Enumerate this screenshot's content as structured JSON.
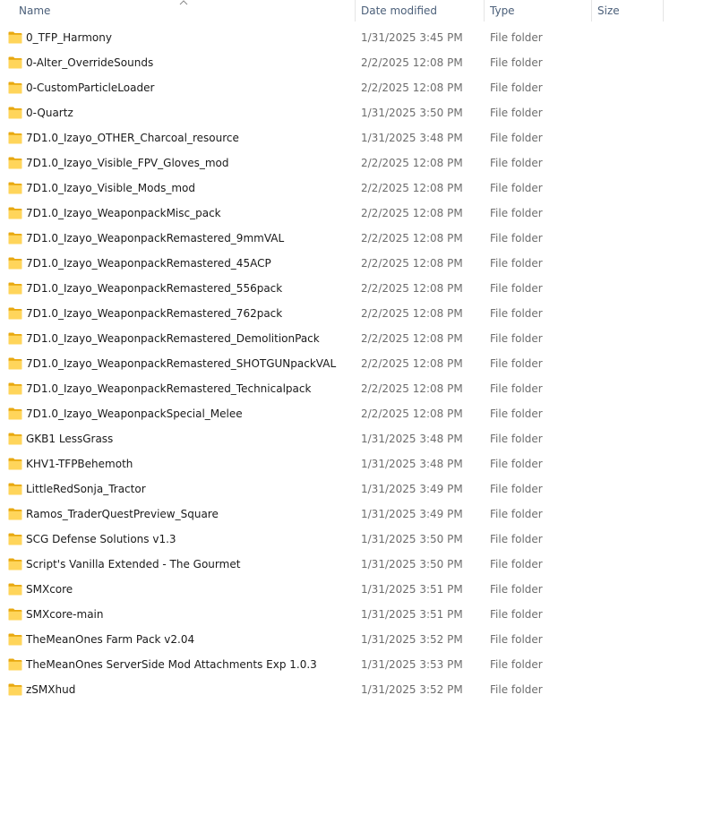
{
  "header": {
    "name": "Name",
    "date_modified": "Date modified",
    "type": "Type",
    "size": "Size"
  },
  "colors": {
    "folder_front": "#ffd55b",
    "folder_back": "#e8a810",
    "header_text": "#4c607a"
  },
  "rows": [
    {
      "name": "0_TFP_Harmony",
      "date": "1/31/2025 3:45 PM",
      "type": "File folder",
      "size": "",
      "icon": "folder-icon"
    },
    {
      "name": "0-Alter_OverrideSounds",
      "date": "2/2/2025 12:08 PM",
      "type": "File folder",
      "size": "",
      "icon": "folder-icon"
    },
    {
      "name": "0-CustomParticleLoader",
      "date": "2/2/2025 12:08 PM",
      "type": "File folder",
      "size": "",
      "icon": "folder-icon"
    },
    {
      "name": "0-Quartz",
      "date": "1/31/2025 3:50 PM",
      "type": "File folder",
      "size": "",
      "icon": "folder-icon"
    },
    {
      "name": "7D1.0_Izayo_OTHER_Charcoal_resource",
      "date": "1/31/2025 3:48 PM",
      "type": "File folder",
      "size": "",
      "icon": "folder-icon"
    },
    {
      "name": "7D1.0_Izayo_Visible_FPV_Gloves_mod",
      "date": "2/2/2025 12:08 PM",
      "type": "File folder",
      "size": "",
      "icon": "folder-icon"
    },
    {
      "name": "7D1.0_Izayo_Visible_Mods_mod",
      "date": "2/2/2025 12:08 PM",
      "type": "File folder",
      "size": "",
      "icon": "folder-icon"
    },
    {
      "name": "7D1.0_Izayo_WeaponpackMisc_pack",
      "date": "2/2/2025 12:08 PM",
      "type": "File folder",
      "size": "",
      "icon": "folder-icon"
    },
    {
      "name": "7D1.0_Izayo_WeaponpackRemastered_9mmVAL",
      "date": "2/2/2025 12:08 PM",
      "type": "File folder",
      "size": "",
      "icon": "folder-icon"
    },
    {
      "name": "7D1.0_Izayo_WeaponpackRemastered_45ACP",
      "date": "2/2/2025 12:08 PM",
      "type": "File folder",
      "size": "",
      "icon": "folder-icon"
    },
    {
      "name": "7D1.0_Izayo_WeaponpackRemastered_556pack",
      "date": "2/2/2025 12:08 PM",
      "type": "File folder",
      "size": "",
      "icon": "folder-icon"
    },
    {
      "name": "7D1.0_Izayo_WeaponpackRemastered_762pack",
      "date": "2/2/2025 12:08 PM",
      "type": "File folder",
      "size": "",
      "icon": "folder-icon"
    },
    {
      "name": "7D1.0_Izayo_WeaponpackRemastered_DemolitionPack",
      "date": "2/2/2025 12:08 PM",
      "type": "File folder",
      "size": "",
      "icon": "folder-icon"
    },
    {
      "name": "7D1.0_Izayo_WeaponpackRemastered_SHOTGUNpackVAL",
      "date": "2/2/2025 12:08 PM",
      "type": "File folder",
      "size": "",
      "icon": "folder-icon"
    },
    {
      "name": "7D1.0_Izayo_WeaponpackRemastered_Technicalpack",
      "date": "2/2/2025 12:08 PM",
      "type": "File folder",
      "size": "",
      "icon": "folder-icon"
    },
    {
      "name": "7D1.0_Izayo_WeaponpackSpecial_Melee",
      "date": "2/2/2025 12:08 PM",
      "type": "File folder",
      "size": "",
      "icon": "folder-icon"
    },
    {
      "name": "GKB1 LessGrass",
      "date": "1/31/2025 3:48 PM",
      "type": "File folder",
      "size": "",
      "icon": "folder-icon"
    },
    {
      "name": "KHV1-TFPBehemoth",
      "date": "1/31/2025 3:48 PM",
      "type": "File folder",
      "size": "",
      "icon": "folder-icon"
    },
    {
      "name": "LittleRedSonja_Tractor",
      "date": "1/31/2025 3:49 PM",
      "type": "File folder",
      "size": "",
      "icon": "folder-icon"
    },
    {
      "name": "Ramos_TraderQuestPreview_Square",
      "date": "1/31/2025 3:49 PM",
      "type": "File folder",
      "size": "",
      "icon": "folder-icon"
    },
    {
      "name": "SCG Defense Solutions v1.3",
      "date": "1/31/2025 3:50 PM",
      "type": "File folder",
      "size": "",
      "icon": "folder-icon"
    },
    {
      "name": "Script's Vanilla Extended - The Gourmet",
      "date": "1/31/2025 3:50 PM",
      "type": "File folder",
      "size": "",
      "icon": "folder-icon"
    },
    {
      "name": "SMXcore",
      "date": "1/31/2025 3:51 PM",
      "type": "File folder",
      "size": "",
      "icon": "folder-icon"
    },
    {
      "name": "SMXcore-main",
      "date": "1/31/2025 3:51 PM",
      "type": "File folder",
      "size": "",
      "icon": "folder-icon"
    },
    {
      "name": "TheMeanOnes Farm Pack v2.04",
      "date": "1/31/2025 3:52 PM",
      "type": "File folder",
      "size": "",
      "icon": "folder-icon"
    },
    {
      "name": "TheMeanOnes ServerSide Mod  Attachments Exp 1.0.3",
      "date": "1/31/2025 3:53 PM",
      "type": "File folder",
      "size": "",
      "icon": "folder-icon"
    },
    {
      "name": "zSMXhud",
      "date": "1/31/2025 3:52 PM",
      "type": "File folder",
      "size": "",
      "icon": "folder-icon"
    }
  ]
}
